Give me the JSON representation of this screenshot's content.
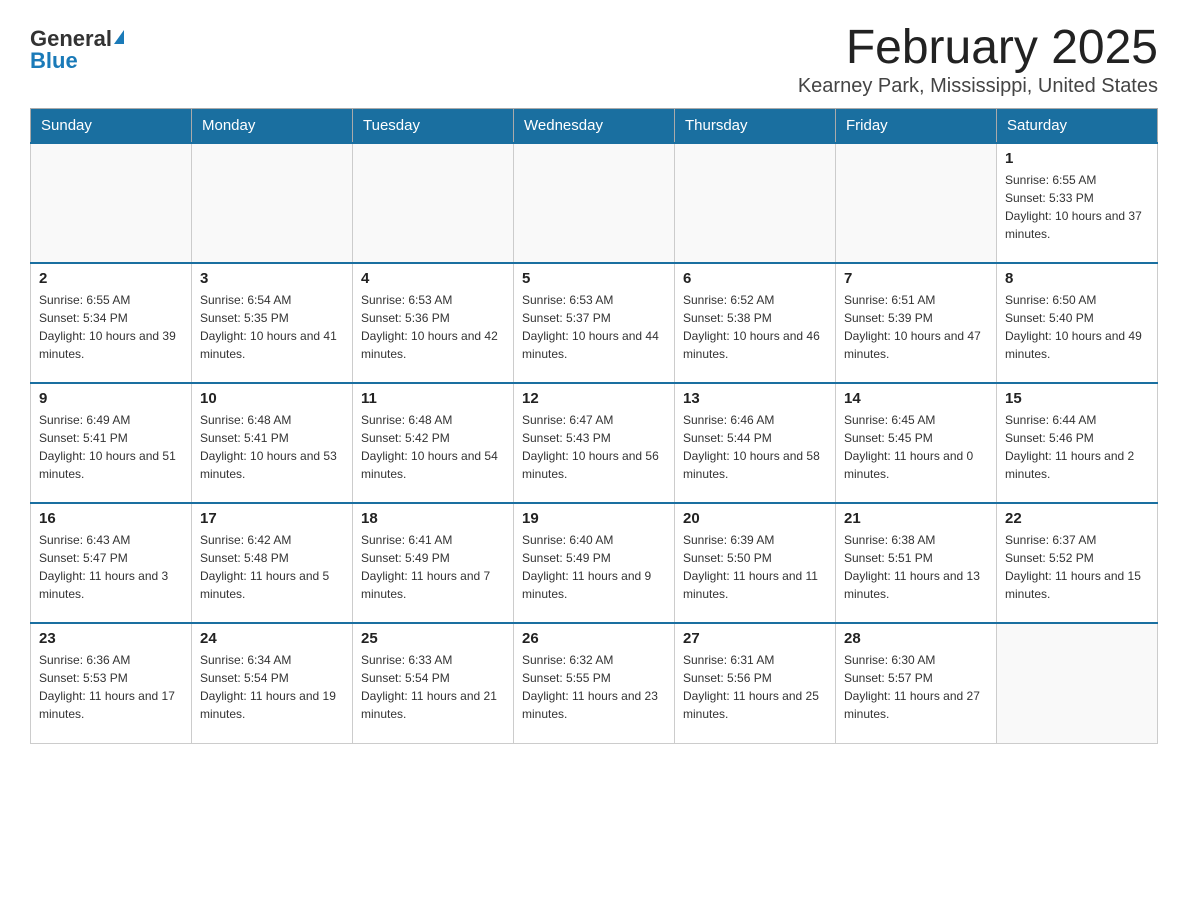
{
  "logo": {
    "general": "General",
    "blue": "Blue"
  },
  "title": "February 2025",
  "subtitle": "Kearney Park, Mississippi, United States",
  "days_of_week": [
    "Sunday",
    "Monday",
    "Tuesday",
    "Wednesday",
    "Thursday",
    "Friday",
    "Saturday"
  ],
  "weeks": [
    [
      {
        "day": "",
        "info": ""
      },
      {
        "day": "",
        "info": ""
      },
      {
        "day": "",
        "info": ""
      },
      {
        "day": "",
        "info": ""
      },
      {
        "day": "",
        "info": ""
      },
      {
        "day": "",
        "info": ""
      },
      {
        "day": "1",
        "info": "Sunrise: 6:55 AM\nSunset: 5:33 PM\nDaylight: 10 hours and 37 minutes."
      }
    ],
    [
      {
        "day": "2",
        "info": "Sunrise: 6:55 AM\nSunset: 5:34 PM\nDaylight: 10 hours and 39 minutes."
      },
      {
        "day": "3",
        "info": "Sunrise: 6:54 AM\nSunset: 5:35 PM\nDaylight: 10 hours and 41 minutes."
      },
      {
        "day": "4",
        "info": "Sunrise: 6:53 AM\nSunset: 5:36 PM\nDaylight: 10 hours and 42 minutes."
      },
      {
        "day": "5",
        "info": "Sunrise: 6:53 AM\nSunset: 5:37 PM\nDaylight: 10 hours and 44 minutes."
      },
      {
        "day": "6",
        "info": "Sunrise: 6:52 AM\nSunset: 5:38 PM\nDaylight: 10 hours and 46 minutes."
      },
      {
        "day": "7",
        "info": "Sunrise: 6:51 AM\nSunset: 5:39 PM\nDaylight: 10 hours and 47 minutes."
      },
      {
        "day": "8",
        "info": "Sunrise: 6:50 AM\nSunset: 5:40 PM\nDaylight: 10 hours and 49 minutes."
      }
    ],
    [
      {
        "day": "9",
        "info": "Sunrise: 6:49 AM\nSunset: 5:41 PM\nDaylight: 10 hours and 51 minutes."
      },
      {
        "day": "10",
        "info": "Sunrise: 6:48 AM\nSunset: 5:41 PM\nDaylight: 10 hours and 53 minutes."
      },
      {
        "day": "11",
        "info": "Sunrise: 6:48 AM\nSunset: 5:42 PM\nDaylight: 10 hours and 54 minutes."
      },
      {
        "day": "12",
        "info": "Sunrise: 6:47 AM\nSunset: 5:43 PM\nDaylight: 10 hours and 56 minutes."
      },
      {
        "day": "13",
        "info": "Sunrise: 6:46 AM\nSunset: 5:44 PM\nDaylight: 10 hours and 58 minutes."
      },
      {
        "day": "14",
        "info": "Sunrise: 6:45 AM\nSunset: 5:45 PM\nDaylight: 11 hours and 0 minutes."
      },
      {
        "day": "15",
        "info": "Sunrise: 6:44 AM\nSunset: 5:46 PM\nDaylight: 11 hours and 2 minutes."
      }
    ],
    [
      {
        "day": "16",
        "info": "Sunrise: 6:43 AM\nSunset: 5:47 PM\nDaylight: 11 hours and 3 minutes."
      },
      {
        "day": "17",
        "info": "Sunrise: 6:42 AM\nSunset: 5:48 PM\nDaylight: 11 hours and 5 minutes."
      },
      {
        "day": "18",
        "info": "Sunrise: 6:41 AM\nSunset: 5:49 PM\nDaylight: 11 hours and 7 minutes."
      },
      {
        "day": "19",
        "info": "Sunrise: 6:40 AM\nSunset: 5:49 PM\nDaylight: 11 hours and 9 minutes."
      },
      {
        "day": "20",
        "info": "Sunrise: 6:39 AM\nSunset: 5:50 PM\nDaylight: 11 hours and 11 minutes."
      },
      {
        "day": "21",
        "info": "Sunrise: 6:38 AM\nSunset: 5:51 PM\nDaylight: 11 hours and 13 minutes."
      },
      {
        "day": "22",
        "info": "Sunrise: 6:37 AM\nSunset: 5:52 PM\nDaylight: 11 hours and 15 minutes."
      }
    ],
    [
      {
        "day": "23",
        "info": "Sunrise: 6:36 AM\nSunset: 5:53 PM\nDaylight: 11 hours and 17 minutes."
      },
      {
        "day": "24",
        "info": "Sunrise: 6:34 AM\nSunset: 5:54 PM\nDaylight: 11 hours and 19 minutes."
      },
      {
        "day": "25",
        "info": "Sunrise: 6:33 AM\nSunset: 5:54 PM\nDaylight: 11 hours and 21 minutes."
      },
      {
        "day": "26",
        "info": "Sunrise: 6:32 AM\nSunset: 5:55 PM\nDaylight: 11 hours and 23 minutes."
      },
      {
        "day": "27",
        "info": "Sunrise: 6:31 AM\nSunset: 5:56 PM\nDaylight: 11 hours and 25 minutes."
      },
      {
        "day": "28",
        "info": "Sunrise: 6:30 AM\nSunset: 5:57 PM\nDaylight: 11 hours and 27 minutes."
      },
      {
        "day": "",
        "info": ""
      }
    ]
  ]
}
